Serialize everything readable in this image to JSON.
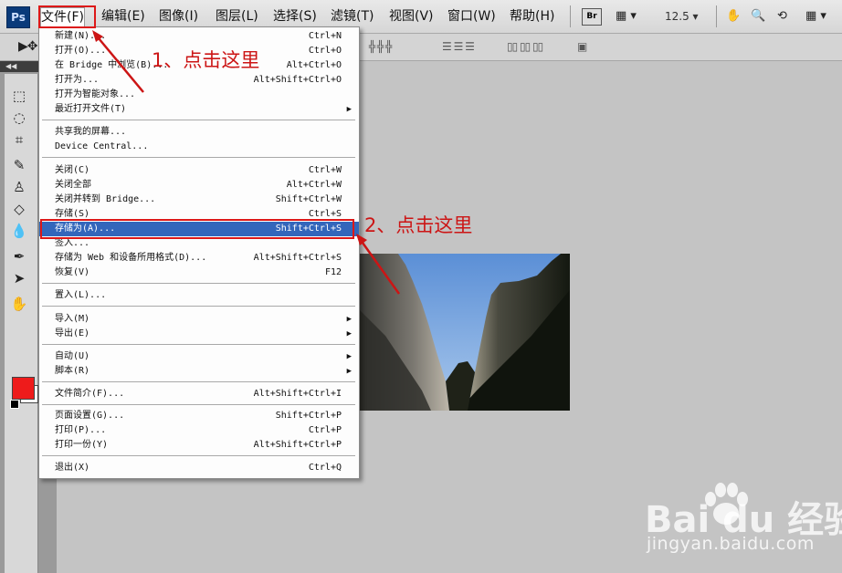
{
  "app": {
    "logo": "Ps"
  },
  "menubar": {
    "items": [
      {
        "label": "文件(F)"
      },
      {
        "label": "编辑(E)"
      },
      {
        "label": "图像(I)"
      },
      {
        "label": "图层(L)"
      },
      {
        "label": "选择(S)"
      },
      {
        "label": "滤镜(T)"
      },
      {
        "label": "视图(V)"
      },
      {
        "label": "窗口(W)"
      },
      {
        "label": "帮助(H)"
      }
    ],
    "bridge_label": "Br",
    "zoom_value": "12.5"
  },
  "file_menu": {
    "groups": [
      [
        {
          "label": "新建(N)...",
          "shortcut": "Ctrl+N"
        },
        {
          "label": "打开(O)...",
          "shortcut": "Ctrl+O"
        },
        {
          "label": "在 Bridge 中浏览(B)...",
          "shortcut": "Alt+Ctrl+O"
        },
        {
          "label": "打开为...",
          "shortcut": "Alt+Shift+Ctrl+O"
        },
        {
          "label": "打开为智能对象...",
          "shortcut": ""
        },
        {
          "label": "最近打开文件(T)",
          "shortcut": "",
          "submenu": true
        }
      ],
      [
        {
          "label": "共享我的屏幕...",
          "shortcut": ""
        },
        {
          "label": "Device Central...",
          "shortcut": ""
        }
      ],
      [
        {
          "label": "关闭(C)",
          "shortcut": "Ctrl+W"
        },
        {
          "label": "关闭全部",
          "shortcut": "Alt+Ctrl+W"
        },
        {
          "label": "关闭并转到 Bridge...",
          "shortcut": "Shift+Ctrl+W"
        },
        {
          "label": "存储(S)",
          "shortcut": "Ctrl+S"
        },
        {
          "label": "存储为(A)...",
          "shortcut": "Shift+Ctrl+S",
          "highlighted": true
        },
        {
          "label": "签入...",
          "shortcut": ""
        },
        {
          "label": "存储为 Web 和设备所用格式(D)...",
          "shortcut": "Alt+Shift+Ctrl+S"
        },
        {
          "label": "恢复(V)",
          "shortcut": "F12"
        }
      ],
      [
        {
          "label": "置入(L)...",
          "shortcut": ""
        }
      ],
      [
        {
          "label": "导入(M)",
          "shortcut": "",
          "submenu": true
        },
        {
          "label": "导出(E)",
          "shortcut": "",
          "submenu": true
        }
      ],
      [
        {
          "label": "自动(U)",
          "shortcut": "",
          "submenu": true
        },
        {
          "label": "脚本(R)",
          "shortcut": "",
          "submenu": true
        }
      ],
      [
        {
          "label": "文件简介(F)...",
          "shortcut": "Alt+Shift+Ctrl+I"
        }
      ],
      [
        {
          "label": "页面设置(G)...",
          "shortcut": "Shift+Ctrl+P"
        },
        {
          "label": "打印(P)...",
          "shortcut": "Ctrl+P"
        },
        {
          "label": "打印一份(Y)",
          "shortcut": "Alt+Shift+Ctrl+P"
        }
      ],
      [
        {
          "label": "退出(X)",
          "shortcut": "Ctrl+Q"
        }
      ]
    ]
  },
  "annotations": {
    "step1": "1、点击这里",
    "step2": "2、点击这里",
    "color": "#cc1515"
  },
  "toolbox": {
    "foreground_color": "#ee1b1b",
    "background_color": "#ffffff"
  },
  "watermark": {
    "logo": "Bai du 经验",
    "url": "jingyan.baidu.com"
  }
}
